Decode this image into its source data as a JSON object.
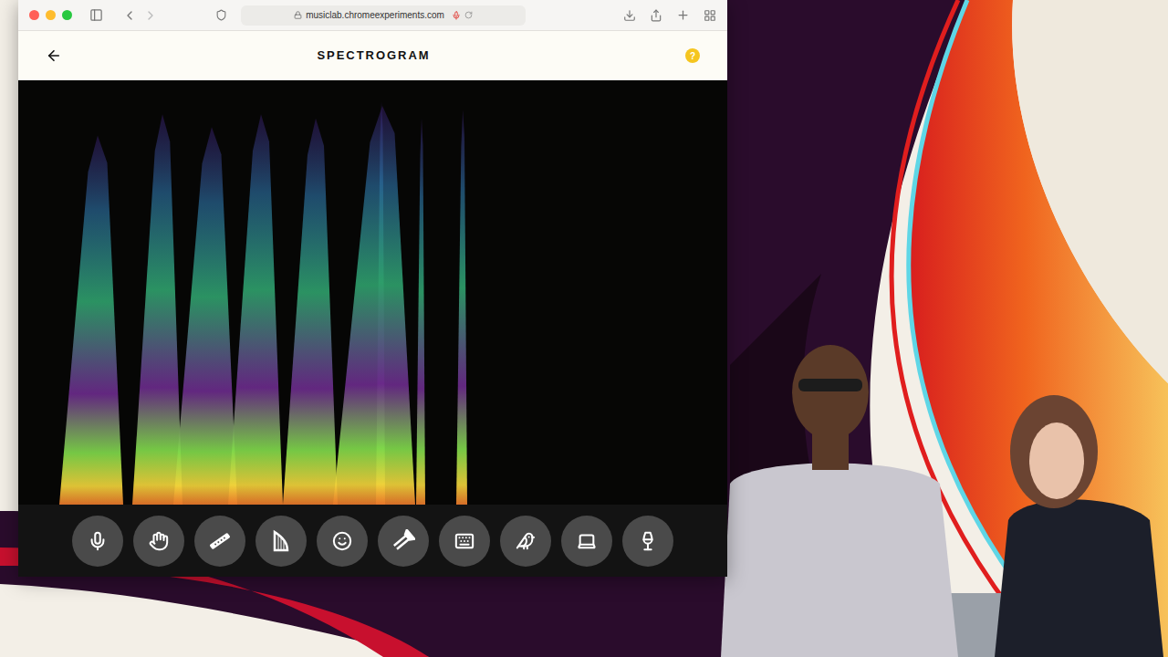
{
  "browser": {
    "url": "musiclab.chromeexperiments.com",
    "mic_recording": true
  },
  "app": {
    "title": "SPECTROGRAM",
    "help": "?"
  },
  "spectrogram": {
    "series": [
      {
        "values": [
          0.87,
          0.92,
          0.89,
          0.92,
          0.91,
          0.94,
          0.95,
          0.91,
          0.93
        ]
      }
    ]
  },
  "tools": [
    {
      "selected": false
    },
    {
      "selected": false
    },
    {
      "selected": false
    },
    {
      "selected": false
    },
    {
      "selected": false
    },
    {
      "selected": false
    },
    {
      "selected": false
    },
    {
      "selected": false
    },
    {
      "selected": false
    },
    {
      "selected": false
    }
  ]
}
